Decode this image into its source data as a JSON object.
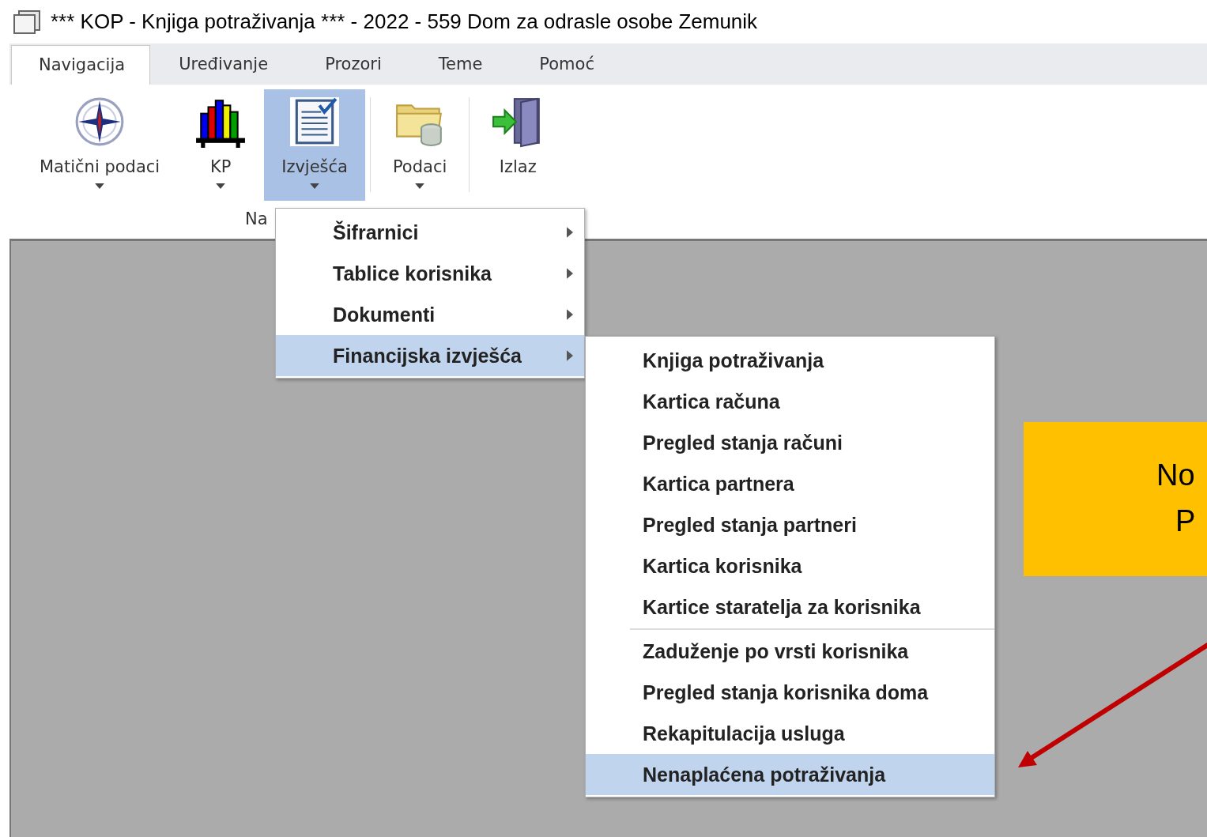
{
  "window": {
    "title": "*** KOP - Knjiga potraživanja *** - 2022 - 559 Dom za odrasle osobe Zemunik"
  },
  "tabs": [
    {
      "label": "Navigacija",
      "selected": true
    },
    {
      "label": "Uređivanje",
      "selected": false
    },
    {
      "label": "Prozori",
      "selected": false
    },
    {
      "label": "Teme",
      "selected": false
    },
    {
      "label": "Pomoć",
      "selected": false
    }
  ],
  "ribbon": {
    "buttons": [
      {
        "kind": "compass",
        "label": "Matični podaci",
        "dropdown": true,
        "selected": false
      },
      {
        "kind": "chart",
        "label": "KP",
        "dropdown": true,
        "selected": false
      },
      {
        "kind": "report",
        "label": "Izvješća",
        "dropdown": true,
        "selected": true
      },
      {
        "kind": "folder",
        "label": "Podaci",
        "dropdown": true,
        "selected": false
      },
      {
        "kind": "exit",
        "label": "Izlaz",
        "dropdown": false,
        "selected": false
      }
    ],
    "group_label": "Na"
  },
  "menu": {
    "items": [
      {
        "label": "Šifrarnici",
        "submenu": true,
        "selected": false
      },
      {
        "label": "Tablice korisnika",
        "submenu": true,
        "selected": false
      },
      {
        "label": "Dokumenti",
        "submenu": true,
        "selected": false
      },
      {
        "label": "Financijska izvješća",
        "submenu": true,
        "selected": true
      }
    ]
  },
  "submenu": {
    "sections": [
      [
        {
          "label": "Knjiga potraživanja",
          "selected": false
        },
        {
          "label": "Kartica računa",
          "selected": false
        },
        {
          "label": "Pregled stanja računi",
          "selected": false
        },
        {
          "label": "Kartica partnera",
          "selected": false
        },
        {
          "label": "Pregled stanja partneri",
          "selected": false
        },
        {
          "label": "Kartica korisnika",
          "selected": false
        },
        {
          "label": "Kartice staratelja za korisnika",
          "selected": false
        }
      ],
      [
        {
          "label": "Zaduženje po vrsti korisnika",
          "selected": false
        },
        {
          "label": "Pregled stanja korisnika doma",
          "selected": false
        },
        {
          "label": "Rekapitulacija usluga",
          "selected": false
        },
        {
          "label": "Nenaplaćena potraživanja",
          "selected": true
        }
      ]
    ]
  },
  "callout": {
    "lines": [
      "No",
      "P"
    ]
  }
}
